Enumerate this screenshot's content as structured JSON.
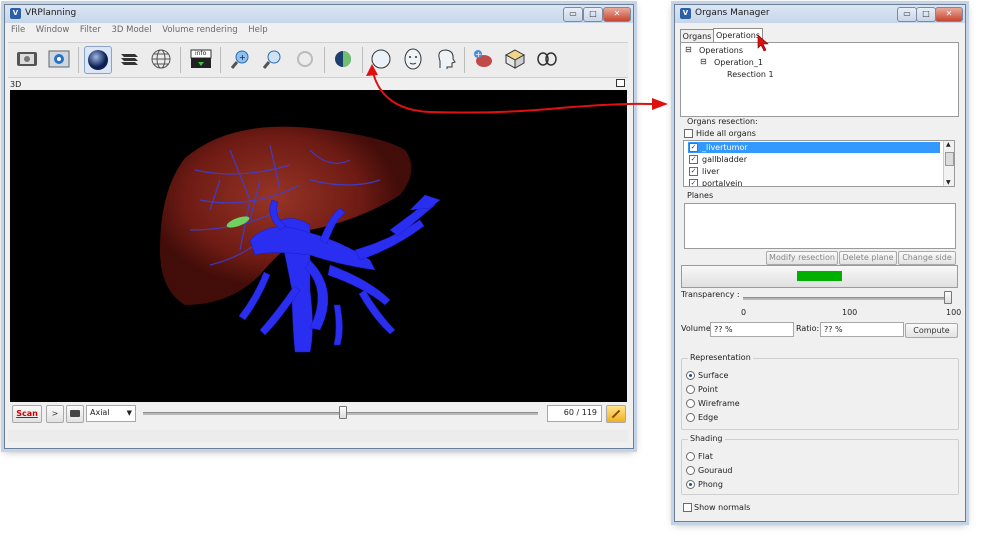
{
  "main_window": {
    "title": "VRPlanning",
    "controls": {
      "minimize": "▭",
      "maximize": "□",
      "close": "✕"
    },
    "menu": [
      "File",
      "Window",
      "Filter",
      "3D Model",
      "Volume rendering",
      "Help"
    ],
    "view_label": "3D",
    "toolbar": {
      "info_label": "info"
    },
    "bottom": {
      "scan_button": "Scan",
      "play_button": ">",
      "orientation_value": "Axial",
      "slice_value": "60 / 119"
    }
  },
  "organs_window": {
    "title": "Organs Manager",
    "controls": {
      "minimize": "▭",
      "maximize": "□",
      "close": "✕"
    },
    "tabs": [
      {
        "label": "Organs"
      },
      {
        "label": "Operations"
      }
    ],
    "tree": {
      "root": "Operations",
      "child": "Operation_1",
      "leaf": "Resection 1"
    },
    "organs_resection_title": "Organs resection:",
    "hide_all_label": "Hide all organs",
    "organs": [
      {
        "label": "_livertumor",
        "checked": "✓"
      },
      {
        "label": "gallbladder",
        "checked": "✓"
      },
      {
        "label": "liver",
        "checked": "✓"
      },
      {
        "label": "portalvein",
        "checked": "✓"
      }
    ],
    "planes_title": "Planes",
    "buttons": {
      "modify": "Modify resection",
      "delete": "Delete plane",
      "change": "Change side",
      "compute": "Compute"
    },
    "transparency_label": "Transparency :",
    "transparency_ticks": [
      "0",
      "100",
      "100"
    ],
    "volume_label": "Volume:",
    "volume_value": "?? %",
    "ratio_label": "Ratio:",
    "ratio_value": "?? %",
    "representation": {
      "title": "Representation",
      "options": [
        "Surface",
        "Point",
        "Wireframe",
        "Edge"
      ],
      "selected": "Surface"
    },
    "shading": {
      "title": "Shading",
      "options": [
        "Flat",
        "Gouraud",
        "Phong"
      ],
      "selected": "Phong"
    },
    "show_normals_label": "Show normals"
  },
  "colors": {
    "accent_arrow": "#e01010",
    "progress": "#00b000",
    "selection": "#3399ff"
  }
}
